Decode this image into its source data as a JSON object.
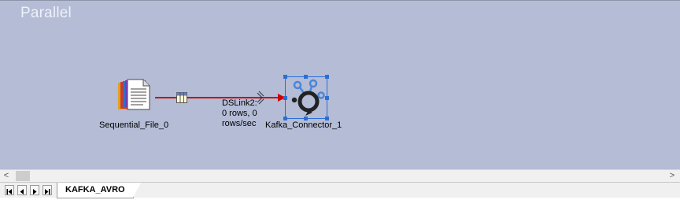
{
  "canvas": {
    "title": "Parallel"
  },
  "stages": {
    "sequential_file": {
      "label": "Sequential_File_0",
      "icon": "sequential-file-icon"
    },
    "kafka": {
      "label": "Kafka_Connector_1",
      "icon": "kafka-connector-icon"
    }
  },
  "link": {
    "name": "DSLink2:",
    "rows_line": "0 rows, 0",
    "rate_line": "rows/sec",
    "color": "#cc0000"
  },
  "scrollbar": {
    "left_arrow": "<",
    "right_arrow": ">"
  },
  "tabs": {
    "active": "KAFKA_AVRO"
  },
  "colors": {
    "canvas": "#b4bcd6",
    "selection": "#2a6fd6"
  }
}
